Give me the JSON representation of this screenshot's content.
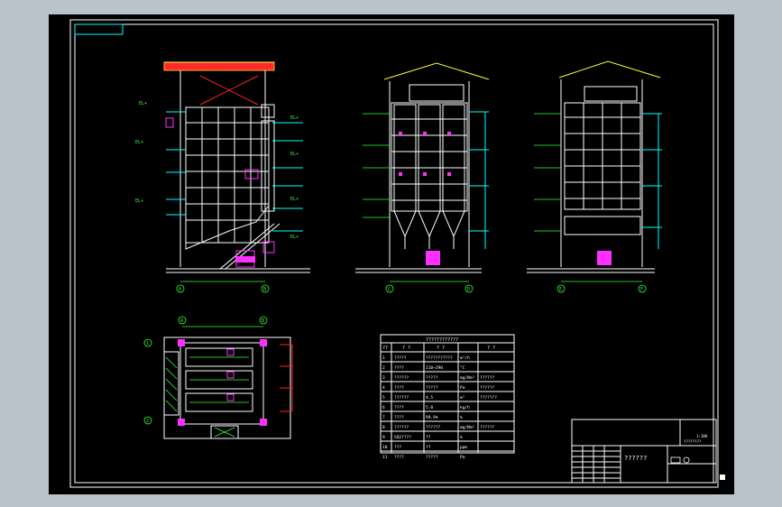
{
  "drawing": {
    "grid_labels": {
      "side": [
        "A",
        "B"
      ],
      "front": [
        "C",
        "D"
      ],
      "back": [
        "E",
        "F"
      ],
      "plan_top": [
        "A",
        "B"
      ],
      "plan_left": [
        "1",
        "2"
      ]
    },
    "spec_table": {
      "title": "????????????",
      "header": [
        "??",
        "? ?",
        "? ?",
        "? ?"
      ],
      "rows": [
        [
          "1",
          "?????",
          "???????????",
          "m³/h",
          ""
        ],
        [
          "2",
          "????",
          "210~290",
          "°C",
          ""
        ],
        [
          "3",
          "??????",
          "?????",
          "mg/Nm³",
          "??????"
        ],
        [
          "4",
          "????",
          "?????",
          "Pa",
          "??????"
        ],
        [
          "5",
          "??????",
          "4.5",
          "m²",
          "???????"
        ],
        [
          "6",
          "????",
          "5.0",
          "kg/h",
          ""
        ],
        [
          "7",
          "????",
          "99.9%",
          "%",
          ""
        ],
        [
          "8",
          "??????",
          "??????",
          "mg/Nm³",
          "??????"
        ],
        [
          "9",
          "SO2????",
          "??",
          "%",
          ""
        ],
        [
          "10",
          "???",
          "??",
          "ppm",
          ""
        ],
        [
          "11",
          "????",
          "?????",
          "Pa",
          ""
        ]
      ]
    },
    "title_block": {
      "label": "??????",
      "corner_small": "1:100",
      "corner_label": "????????"
    }
  }
}
